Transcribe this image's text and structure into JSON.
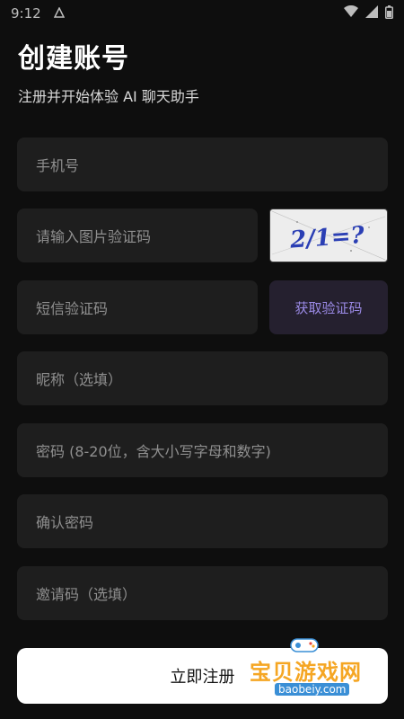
{
  "status_bar": {
    "time": "9:12"
  },
  "header": {
    "title": "创建账号",
    "subtitle": "注册并开始体验 AI 聊天助手"
  },
  "form": {
    "phone_placeholder": "手机号",
    "image_captcha_placeholder": "请输入图片验证码",
    "captcha_text": "2/1=?",
    "sms_code_placeholder": "短信验证码",
    "get_code_label": "获取验证码",
    "nickname_placeholder": "昵称（选填）",
    "password_placeholder": "密码 (8-20位，含大小写字母和数字)",
    "confirm_password_placeholder": "确认密码",
    "invite_code_placeholder": "邀请码（选填）",
    "submit_label": "立即注册"
  },
  "watermark": {
    "name": "宝贝游戏网",
    "url": "baobeiy.com"
  },
  "colors": {
    "background": "#0e0e0e",
    "field": "#1e1e1e",
    "accent_text": "#9b8ae6",
    "sms_button": "#25202f",
    "submit_bg": "#ffffff"
  }
}
